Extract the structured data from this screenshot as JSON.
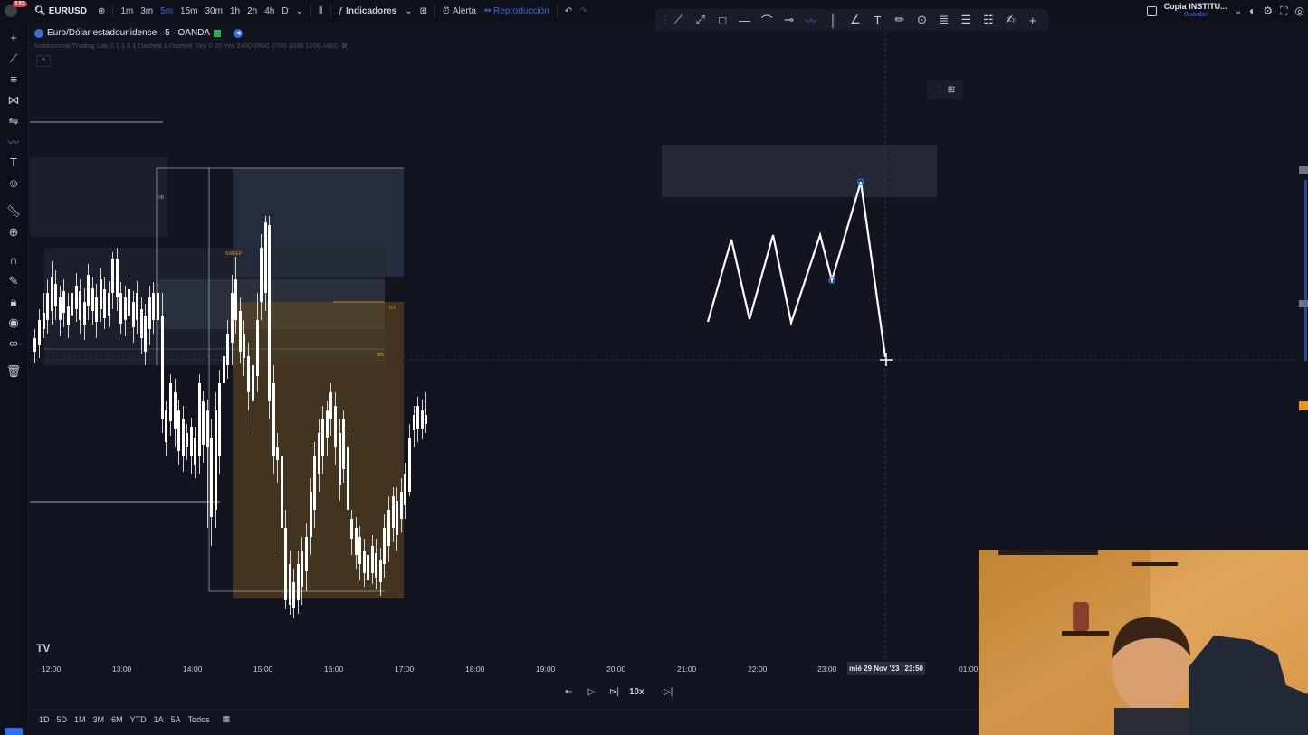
{
  "topbar": {
    "notification_count": "133",
    "symbol": "EURUSD",
    "intervals": [
      "1m",
      "3m",
      "5m",
      "15m",
      "30m",
      "1h",
      "2h",
      "4h",
      "D"
    ],
    "active_interval": "5m",
    "indicators_label": "Indicadores",
    "alert_label": "Alerta",
    "replay_label": "Reproducción",
    "layout_name": "Copia INSTITU...",
    "save_label": "Guardar"
  },
  "legend": {
    "title": "Euro/Dólar estadounidense · 5 · OANDA",
    "indicator": "Institucional Trading Lab 2.1 1 9 1 Dashed 1 Dashed Tiny 0 20 Yes 2400-0500 0700-1030 1200-1600"
  },
  "chart_labels": {
    "ob": "OB",
    "sweep": "SWEEP",
    "level_05": "0.5",
    "level_bb": "BB"
  },
  "time_axis": [
    "12:00",
    "13:00",
    "14:00",
    "15:00",
    "16:00",
    "17:00",
    "18:00",
    "19:00",
    "20:00",
    "21:00",
    "22:00",
    "23:00",
    "01:00"
  ],
  "crosshair": {
    "date": "mié 29 Nov '23",
    "time": "23:50"
  },
  "replay": {
    "speed": "10x"
  },
  "ranges": [
    "1D",
    "5D",
    "1M",
    "3M",
    "6M",
    "YTD",
    "1A",
    "5A",
    "Todos"
  ],
  "colors": {
    "accent": "#2f6df0",
    "bull_candle": "#ffffff",
    "bear_candle": "#f0960c",
    "background": "#121520"
  },
  "icons": {
    "left_toolbar": [
      "crosshair-icon",
      "trend-line-icon",
      "fib-icon",
      "pattern-icon",
      "prediction-icon",
      "path-icon",
      "text-icon",
      "emoji-icon",
      "ruler-icon",
      "zoom-in-icon",
      "magnet-icon",
      "stay-drawing-icon",
      "lock-icon",
      "eye-icon",
      "link-icon",
      "trash-icon"
    ],
    "draw_toolbar": [
      "trend-line-icon",
      "brush-icon",
      "rectangle-icon",
      "horizontal-line-icon",
      "pen-icon",
      "horizontal-ray-icon",
      "path-icon",
      "vertical-line-icon",
      "angle-icon",
      "pencil-icon",
      "text-icon",
      "circle-icon",
      "fib-icon",
      "parallel-channel-icon",
      "list-icon",
      "paint-icon",
      "crosshair-icon"
    ]
  }
}
